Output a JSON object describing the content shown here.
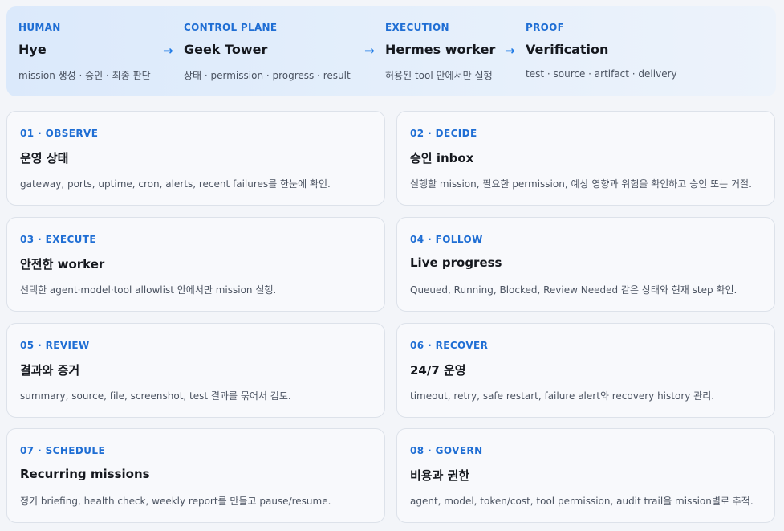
{
  "flow": {
    "stages": [
      {
        "kicker": "HUMAN",
        "title": "Hye",
        "desc": "mission 생성 · 승인 · 최종 판단"
      },
      {
        "kicker": "CONTROL PLANE",
        "title": "Geek Tower",
        "desc": "상태 · permission · progress · result"
      },
      {
        "kicker": "EXECUTION",
        "title": "Hermes worker",
        "desc": "허용된 tool 안에서만 실행"
      },
      {
        "kicker": "PROOF",
        "title": "Verification",
        "desc": "test · source · artifact · delivery"
      }
    ],
    "arrow_glyph": "→",
    "accent_color": "#1f6ed4"
  },
  "cards": [
    {
      "kicker": "01 · OBSERVE",
      "title": "운영 상태",
      "desc": "gateway, ports, uptime, cron, alerts, recent failures를 한눈에 확인."
    },
    {
      "kicker": "02 · DECIDE",
      "title": "승인 inbox",
      "desc": "실행할 mission, 필요한 permission, 예상 영향과 위험을 확인하고 승인 또는 거절."
    },
    {
      "kicker": "03 · EXECUTE",
      "title": "안전한 worker",
      "desc": "선택한 agent·model·tool allowlist 안에서만 mission 실행."
    },
    {
      "kicker": "04 · FOLLOW",
      "title": "Live progress",
      "desc": "Queued, Running, Blocked, Review Needed 같은 상태와 현재 step 확인."
    },
    {
      "kicker": "05 · REVIEW",
      "title": "결과와 증거",
      "desc": "summary, source, file, screenshot, test 결과를 묶어서 검토."
    },
    {
      "kicker": "06 · RECOVER",
      "title": "24/7 운영",
      "desc": "timeout, retry, safe restart, failure alert와 recovery history 관리."
    },
    {
      "kicker": "07 · SCHEDULE",
      "title": "Recurring missions",
      "desc": "정기 briefing, health check, weekly report를 만들고 pause/resume."
    },
    {
      "kicker": "08 · GOVERN",
      "title": "비용과 권한",
      "desc": "agent, model, token/cost, tool permission, audit trail을 mission별로 추적."
    }
  ]
}
